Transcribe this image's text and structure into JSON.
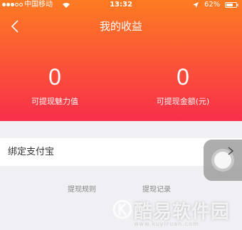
{
  "status_bar": {
    "carrier": "中国移动",
    "time": "13:32",
    "battery": "62%",
    "icons": [
      "signal-dots",
      "wifi-icon",
      "location-icon",
      "battery-icon"
    ]
  },
  "header": {
    "title": "我的收益",
    "back_icon": "chevron-left-icon"
  },
  "stats": {
    "charm": {
      "value": "0",
      "label": "可提现魅力值"
    },
    "amount": {
      "value": "0",
      "label": "可提现金额(元)"
    }
  },
  "alipay": {
    "label": "绑定支付宝",
    "icon": "chevron-right-icon"
  },
  "links": {
    "rules": "提现规则",
    "records": "提现记录"
  },
  "watermark": {
    "text": "酷易软件园",
    "url": "www.kuyiruan.com"
  },
  "colors": {
    "gradient_top": "#fd7b22",
    "gradient_bottom": "#f82f4b",
    "background": "#efeff4"
  }
}
